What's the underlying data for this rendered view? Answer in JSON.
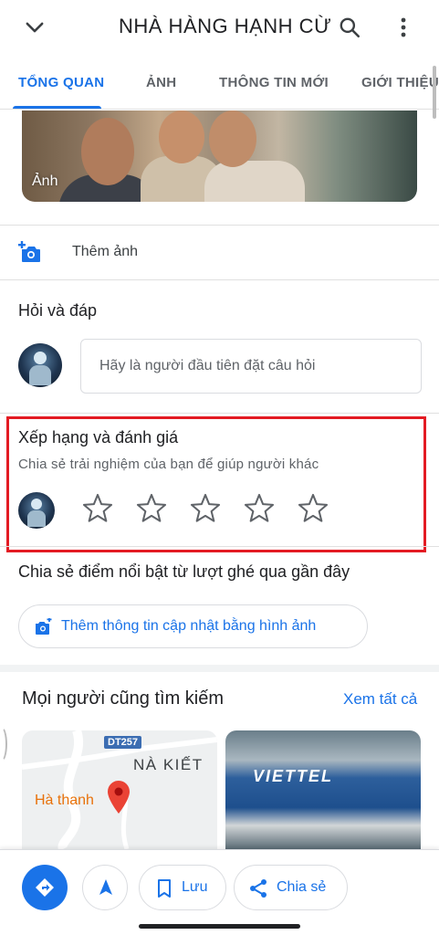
{
  "header": {
    "title": "NHÀ HÀNG HẠNH CỪ"
  },
  "tabs": [
    {
      "label": "TỔNG QUAN",
      "active": true
    },
    {
      "label": "ẢNH",
      "active": false
    },
    {
      "label": "THÔNG TIN MỚI",
      "active": false
    },
    {
      "label": "GIỚI THIỆU",
      "active": false
    }
  ],
  "photo": {
    "label": "Ảnh"
  },
  "add_photo": {
    "label": "Thêm ảnh",
    "icon": "add-photo-icon"
  },
  "qa": {
    "title": "Hỏi và đáp",
    "placeholder": "Hãy là người đầu tiên đặt câu hỏi"
  },
  "rating": {
    "title": "Xếp hạng và đánh giá",
    "subtitle": "Chia sẻ trải nghiệm của bạn để giúp người khác",
    "stars_total": 5,
    "stars_selected": 0,
    "highlight_color": "#e31b23"
  },
  "highlights": {
    "title": "Chia sẻ điểm nổi bật từ lượt ghé qua gần đây",
    "button_label": "Thêm thông tin cập nhật bằng hình ảnh"
  },
  "people_search": {
    "title": "Mọi người cũng tìm kiếm",
    "see_all": "Xem tất cả",
    "map_card": {
      "road": "DT257",
      "area": "NÀ KIẾT",
      "place": "Hà thanh"
    },
    "shop_card": {
      "sign": "VIETTEL"
    }
  },
  "actions": {
    "directions_icon": "directions-icon",
    "start_icon": "navigation-arrow-icon",
    "save_label": "Lưu",
    "share_label": "Chia sẻ"
  },
  "colors": {
    "accent": "#1a73e8",
    "text": "#202124",
    "secondary": "#5f6368",
    "star_outline": "#5f6368"
  }
}
